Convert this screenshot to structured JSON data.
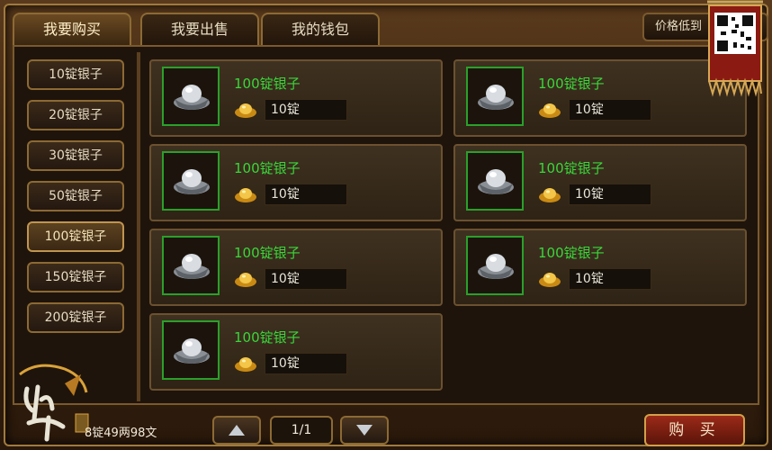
{
  "tabs": [
    {
      "label": "我要购买"
    },
    {
      "label": "我要出售"
    },
    {
      "label": "我的钱包"
    }
  ],
  "sort_label": "价格低到",
  "sidebar": {
    "items": [
      {
        "label": "10锭银子"
      },
      {
        "label": "20锭银子"
      },
      {
        "label": "30锭银子"
      },
      {
        "label": "50锭银子"
      },
      {
        "label": "100锭银子"
      },
      {
        "label": "150锭银子"
      },
      {
        "label": "200锭银子"
      }
    ],
    "active_index": 4
  },
  "listings": [
    {
      "name": "100锭银子",
      "price": "10锭"
    },
    {
      "name": "100锭银子",
      "price": "10锭"
    },
    {
      "name": "100锭银子",
      "price": "10锭"
    },
    {
      "name": "100锭银子",
      "price": "10锭"
    },
    {
      "name": "100锭银子",
      "price": "10锭"
    },
    {
      "name": "100锭银子",
      "price": "10锭"
    },
    {
      "name": "100锭银子",
      "price": "10锭"
    }
  ],
  "footer": {
    "money": "8锭49两98文",
    "page": "1/1",
    "buy_label": "购 买"
  },
  "colors": {
    "item_name": "#3ad63a",
    "thumb_border": "#2aa02a",
    "buy_button": "#9b2a18"
  },
  "icons": {
    "thumb": "silver-ingot-icon",
    "price": "gold-ingot-icon"
  }
}
